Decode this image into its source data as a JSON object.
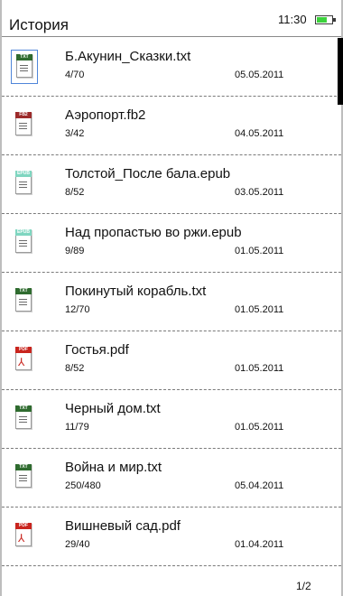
{
  "header": {
    "title": "История",
    "time": "11:30",
    "battery_level": 0.7,
    "battery_color": "#3cd23c"
  },
  "files": [
    {
      "name": "Б.Акунин_Сказки.txt",
      "progress": "4/70",
      "date": "05.05.2011",
      "type": "TXT",
      "selected": true
    },
    {
      "name": "Аэропорт.fb2",
      "progress": "3/42",
      "date": "04.05.2011",
      "type": "FB2"
    },
    {
      "name": "Толстой_После бала.epub",
      "progress": "8/52",
      "date": "03.05.2011",
      "type": "EPUB"
    },
    {
      "name": "Над пропастью во ржи.epub",
      "progress": "9/89",
      "date": "01.05.2011",
      "type": "EPUB"
    },
    {
      "name": "Покинутый корабль.txt",
      "progress": "12/70",
      "date": "01.05.2011",
      "type": "TXT"
    },
    {
      "name": "Гостья.pdf",
      "progress": "8/52",
      "date": "01.05.2011",
      "type": "PDF"
    },
    {
      "name": "Черный дом.txt",
      "progress": "11/79",
      "date": "01.05.2011",
      "type": "TXT"
    },
    {
      "name": "Война и мир.txt",
      "progress": "250/480",
      "date": "05.04.2011",
      "type": "TXT"
    },
    {
      "name": "Вишневый сад.pdf",
      "progress": "29/40",
      "date": "01.04.2011",
      "type": "PDF"
    }
  ],
  "type_colors": {
    "TXT": "#2f6b2f",
    "FB2": "#9c2a2a",
    "EPUB": "#7fd6c0",
    "PDF": "#c9251e"
  },
  "footer": {
    "page": "1/2"
  }
}
